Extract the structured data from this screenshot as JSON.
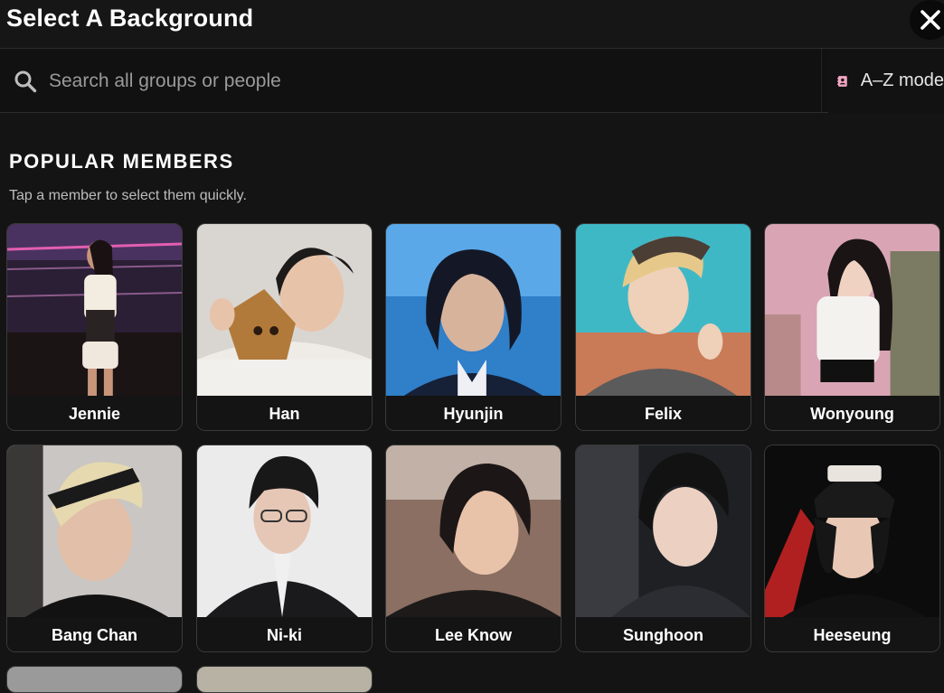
{
  "header": {
    "title": "Select A Background",
    "close_icon": "close-icon"
  },
  "search": {
    "placeholder": "Search all groups or people",
    "value": "",
    "icon": "search-icon"
  },
  "az_mode": {
    "label": "A–Z mode",
    "icon": "contact-book-icon",
    "icon_color": "#f2a7c3"
  },
  "section": {
    "title": "POPULAR MEMBERS",
    "subtitle": "Tap a member to select them quickly."
  },
  "members": [
    {
      "name": "Jennie"
    },
    {
      "name": "Han"
    },
    {
      "name": "Hyunjin"
    },
    {
      "name": "Felix"
    },
    {
      "name": "Wonyoung"
    },
    {
      "name": "Bang Chan"
    },
    {
      "name": "Ni-ki"
    },
    {
      "name": "Lee Know"
    },
    {
      "name": "Sunghoon"
    },
    {
      "name": "Heeseung"
    }
  ]
}
